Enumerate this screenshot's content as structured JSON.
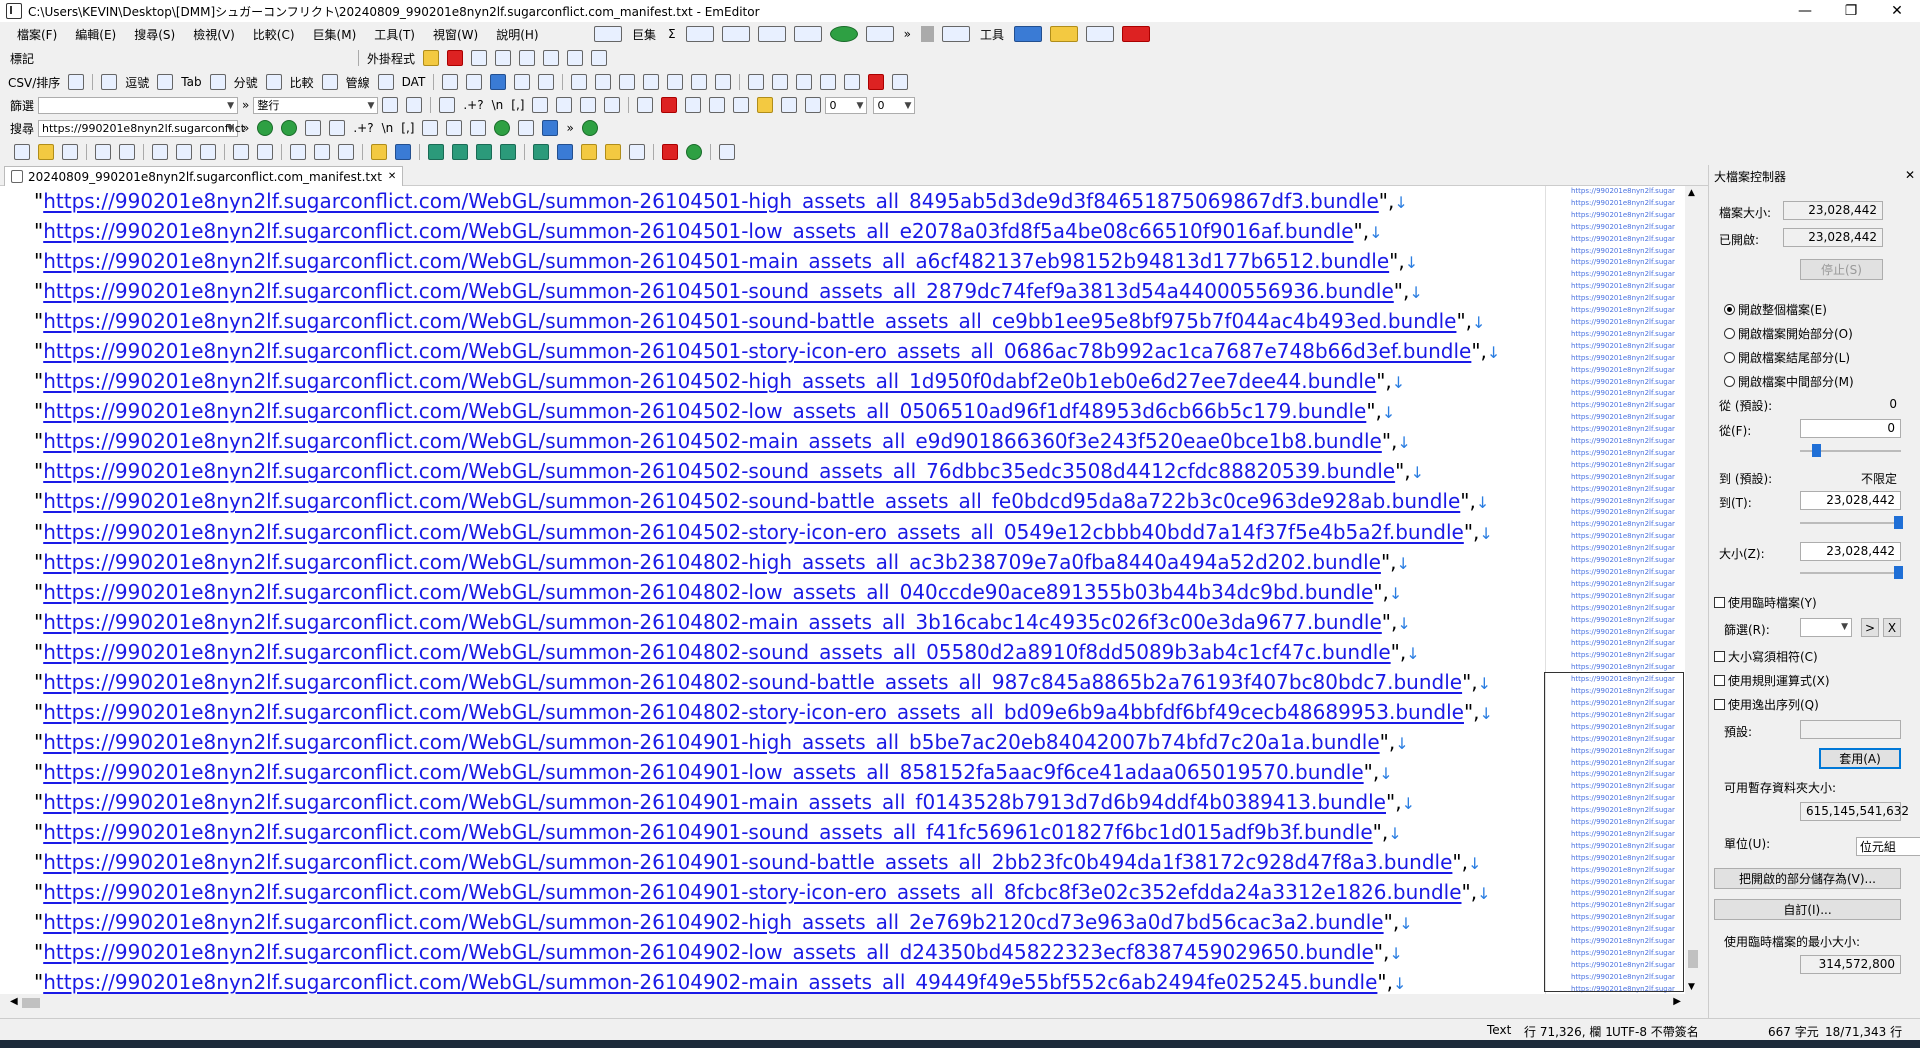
{
  "window": {
    "title": "C:\\Users\\KEVIN\\Desktop\\[DMM]シュガーコンフリクト\\20240809_990201e8nyn2lf.sugarconflict.com_manifest.txt - EmEditor",
    "minimize": "—",
    "maximize": "❐",
    "close": "✕"
  },
  "menu": [
    "檔案(F)",
    "編輯(E)",
    "搜尋(S)",
    "檢視(V)",
    "比較(C)",
    "巨集(M)",
    "工具(T)",
    "視窗(W)",
    "說明(H)"
  ],
  "menu2": {
    "macros": "巨集",
    "sigma": "Σ",
    "tools": "工具",
    "more": "»"
  },
  "toolbar": {
    "bookmark_label": "標記",
    "external_label": "外掛程式",
    "csv_label": "CSV/排序",
    "csv_buttons": [
      "逗號",
      "Tab",
      "分號",
      "比較",
      "管線",
      "DAT"
    ],
    "filter_label": "篩選",
    "filter_mode": "整行",
    "search_label": "搜尋",
    "search_value": "https://990201e8nyn2lf.sugarconflict",
    "combo_zero_a": "0",
    "combo_zero_b": "0",
    "regex_label": "\\n",
    "bracket_label": "[,]",
    "more": "»"
  },
  "tab": {
    "filename": "20240809_990201e8nyn2lf.sugarconflict.com_manifest.txt",
    "close": "✕"
  },
  "editor": {
    "lines": [
      "https://990201e8nyn2lf.sugarconflict.com/WebGL/summon-26104501-high_assets_all_8495ab5d3de9d3f84651875069867df3.bundle",
      "https://990201e8nyn2lf.sugarconflict.com/WebGL/summon-26104501-low_assets_all_e2078a03fd8f5a4be08c66510f9016af.bundle",
      "https://990201e8nyn2lf.sugarconflict.com/WebGL/summon-26104501-main_assets_all_a6cf482137eb98152b94813d177b6512.bundle",
      "https://990201e8nyn2lf.sugarconflict.com/WebGL/summon-26104501-sound_assets_all_2879dc74fef9a3813d54a44000556936.bundle",
      "https://990201e8nyn2lf.sugarconflict.com/WebGL/summon-26104501-sound-battle_assets_all_ce9bb1ee95e8bf975b7f044ac4b493ed.bundle",
      "https://990201e8nyn2lf.sugarconflict.com/WebGL/summon-26104501-story-icon-ero_assets_all_0686ac78b992ac1ca7687e748b66d3ef.bundle",
      "https://990201e8nyn2lf.sugarconflict.com/WebGL/summon-26104502-high_assets_all_1d950f0dabf2e0b1eb0e6d27ee7dee44.bundle",
      "https://990201e8nyn2lf.sugarconflict.com/WebGL/summon-26104502-low_assets_all_0506510ad96f1df48953d6cb66b5c179.bundle",
      "https://990201e8nyn2lf.sugarconflict.com/WebGL/summon-26104502-main_assets_all_e9d901866360f3e243f520eae0bce1b8.bundle",
      "https://990201e8nyn2lf.sugarconflict.com/WebGL/summon-26104502-sound_assets_all_76dbbc35edc3508d4412cfdc88820539.bundle",
      "https://990201e8nyn2lf.sugarconflict.com/WebGL/summon-26104502-sound-battle_assets_all_fe0bdcd95da8a722b3c0ce963de928ab.bundle",
      "https://990201e8nyn2lf.sugarconflict.com/WebGL/summon-26104502-story-icon-ero_assets_all_0549e12cbbb40bdd7a14f37f5e4b5a2f.bundle",
      "https://990201e8nyn2lf.sugarconflict.com/WebGL/summon-26104802-high_assets_all_ac3b238709e7a0fba8440a494a52d202.bundle",
      "https://990201e8nyn2lf.sugarconflict.com/WebGL/summon-26104802-low_assets_all_040ccde90ace891355b03b44b34dc9bd.bundle",
      "https://990201e8nyn2lf.sugarconflict.com/WebGL/summon-26104802-main_assets_all_3b16cabc14c4935c026f3c00e3da9677.bundle",
      "https://990201e8nyn2lf.sugarconflict.com/WebGL/summon-26104802-sound_assets_all_05580d2a8910f8dd5089b3ab4c1cf47c.bundle",
      "https://990201e8nyn2lf.sugarconflict.com/WebGL/summon-26104802-sound-battle_assets_all_987c845a8865b2a76193f407bc80bdc7.bundle",
      "https://990201e8nyn2lf.sugarconflict.com/WebGL/summon-26104802-story-icon-ero_assets_all_bd09e6b9a4bbfdf6bf49cecb48689953.bundle",
      "https://990201e8nyn2lf.sugarconflict.com/WebGL/summon-26104901-high_assets_all_b5be7ac20eb84042007b74bfd7c20a1a.bundle",
      "https://990201e8nyn2lf.sugarconflict.com/WebGL/summon-26104901-low_assets_all_858152fa5aac9f6ce41adaa065019570.bundle",
      "https://990201e8nyn2lf.sugarconflict.com/WebGL/summon-26104901-main_assets_all_f0143528b7913d7d6b94ddf4b0389413.bundle",
      "https://990201e8nyn2lf.sugarconflict.com/WebGL/summon-26104901-sound_assets_all_f41fc56961c01827f6bc1d015adf9b3f.bundle",
      "https://990201e8nyn2lf.sugarconflict.com/WebGL/summon-26104901-sound-battle_assets_all_2bb23fc0b494da1f38172c928d47f8a3.bundle",
      "https://990201e8nyn2lf.sugarconflict.com/WebGL/summon-26104901-story-icon-ero_assets_all_8fcbc8f3e02c352efdda24a3312e1826.bundle",
      "https://990201e8nyn2lf.sugarconflict.com/WebGL/summon-26104902-high_assets_all_2e769b2120cd73e963a0d7bd56cac3a2.bundle",
      "https://990201e8nyn2lf.sugarconflict.com/WebGL/summon-26104902-low_assets_all_d24350bd45822323ecf8387459029650.bundle",
      "https://990201e8nyn2lf.sugarconflict.com/WebGL/summon-26104902-main_assets_all_49449f49e55bf552c6ab2494fe025245.bundle"
    ],
    "minimap_text": "https://990201e8nyn2lf.sugar"
  },
  "panel": {
    "title": "大檔案控制器",
    "close": "✕",
    "file_size_label": "檔案大小:",
    "file_size": "23,028,442",
    "opened_label": "已開啟:",
    "opened": "23,028,442",
    "stop_button": "停止(S)",
    "radios": [
      "開啟整個檔案(E)",
      "開啟檔案開始部分(O)",
      "開啟檔案結尾部分(L)",
      "開啟檔案中間部分(M)"
    ],
    "from_default_label": "從 (預設):",
    "from_default": "0",
    "from_label": "從(F):",
    "from_value": "0",
    "to_default_label": "到 (預設):",
    "to_default": "不限定",
    "to_label": "到(T):",
    "to_value": "23,028,442",
    "size_label": "大小(Z):",
    "size_value": "23,028,442",
    "use_temp_label": "使用臨時檔案(Y)",
    "filter_label": "篩選(R):",
    "next_btn": ">",
    "x_btn": "X",
    "match_case": "大小寫須相符(C)",
    "use_regex": "使用規則運算式(X)",
    "use_escape": "使用逸出序列(Q)",
    "preset_label": "預設:",
    "apply_button": "套用(A)",
    "free_space_label": "可用暫存資料夾大小:",
    "free_space": "615,145,541,632",
    "unit_label": "單位(U):",
    "unit_value": "位元組",
    "save_part_button": "把開啟的部分儲存為(V)...",
    "custom_button": "自訂(I)...",
    "min_temp_label": "使用臨時檔案的最小大小:",
    "min_temp": "314,572,800"
  },
  "status": {
    "mode": "Text",
    "position": "行 71,326, 欄 1",
    "encoding": "UTF-8 不帶簽名",
    "chars": "667 字元",
    "lines": "18/71,343 行"
  }
}
